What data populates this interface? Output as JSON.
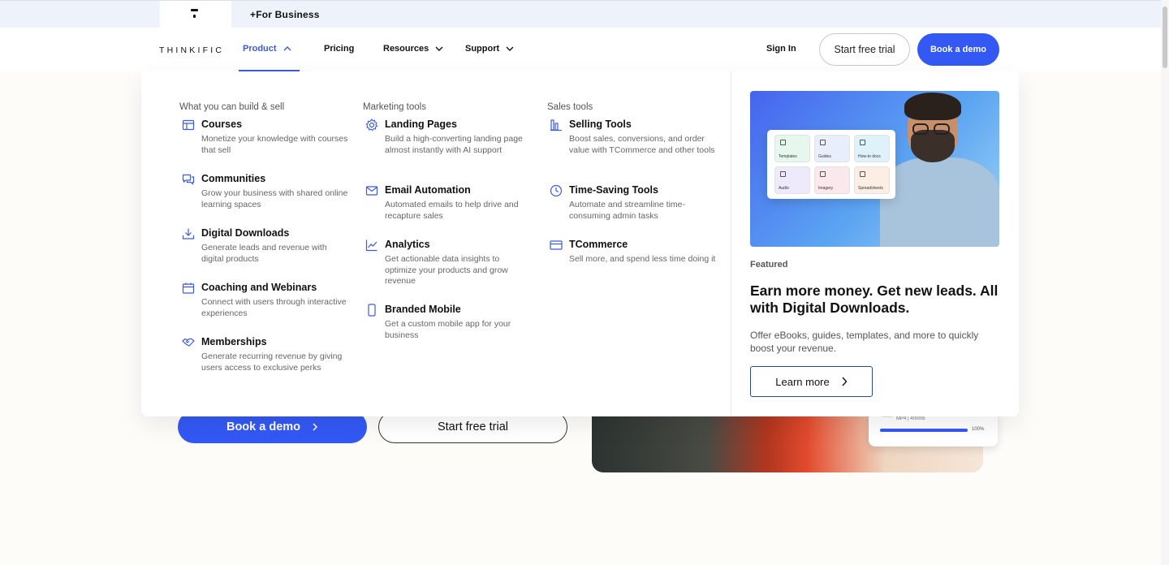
{
  "topbar": {
    "for_business": "+For Business"
  },
  "nav": {
    "logo": "THINKIFIC",
    "items": [
      {
        "label": "Product",
        "has_menu": true,
        "active": true
      },
      {
        "label": "Pricing",
        "has_menu": false,
        "active": false
      },
      {
        "label": "Resources",
        "has_menu": true,
        "active": false
      },
      {
        "label": "Support",
        "has_menu": true,
        "active": false
      }
    ],
    "sign_in": "Sign In",
    "start_trial": "Start free trial",
    "book_demo": "Book a demo",
    "accent_color": "#3358f4"
  },
  "menu": {
    "columns": [
      {
        "heading": "What you can build & sell",
        "entries": [
          {
            "icon": "layout-icon",
            "title": "Courses",
            "desc": "Monetize your knowledge with courses that sell"
          },
          {
            "icon": "chat-icon",
            "title": "Communities",
            "desc": "Grow your business with shared online learning spaces"
          },
          {
            "icon": "download-icon",
            "title": "Digital Downloads",
            "desc": "Generate leads and revenue with digital products"
          },
          {
            "icon": "calendar-icon",
            "title": "Coaching and Webinars",
            "desc": "Connect with users through interactive experiences"
          },
          {
            "icon": "handshake-icon",
            "title": "Memberships",
            "desc": "Generate recurring revenue by giving users access to exclusive perks"
          }
        ]
      },
      {
        "heading": "Marketing tools",
        "entries": [
          {
            "icon": "gear-icon",
            "title": "Landing Pages",
            "desc": "Build a high-converting landing page almost instantly with AI support"
          },
          {
            "icon": "mail-icon",
            "title": "Email Automation",
            "desc": "Automated emails to help drive and recapture sales"
          },
          {
            "icon": "analytics-icon",
            "title": "Analytics",
            "desc": "Get actionable data insights to optimize your products and grow revenue"
          },
          {
            "icon": "mobile-icon",
            "title": "Branded Mobile",
            "desc": "Get a custom mobile app for your business"
          }
        ]
      },
      {
        "heading": "Sales tools",
        "entries": [
          {
            "icon": "bar-chart-icon",
            "title": "Selling Tools",
            "desc": "Boost sales, conversions, and order value with TCommerce and other tools"
          },
          {
            "icon": "clock-icon",
            "title": "Time-Saving Tools",
            "desc": "Automate and streamline time-consuming admin tasks"
          },
          {
            "icon": "card-icon",
            "title": "TCommerce",
            "desc": "Sell more, and spend less time doing it"
          }
        ]
      }
    ]
  },
  "featured": {
    "label": "Featured",
    "title": "Earn more money. Get new leads. All with Digital Downloads.",
    "description": "Offer eBooks, guides, templates, and more to quickly boost your revenue.",
    "cta": "Learn more",
    "tiles": [
      {
        "label": "Templates",
        "color": "#e6f7ee"
      },
      {
        "label": "Guides",
        "color": "#e8eefb"
      },
      {
        "label": "How-to docs",
        "color": "#dff1fb"
      },
      {
        "label": "Audio",
        "color": "#eee9fb"
      },
      {
        "label": "Imagery",
        "color": "#fbe8ec"
      },
      {
        "label": "Spreadsheets",
        "color": "#fdeee4"
      }
    ]
  },
  "hero": {
    "book_demo": "Book a demo",
    "start_trial": "Start free trial",
    "upload_meta": "MP4 | 400mb",
    "upload_pct": "100%",
    "upload_progress": 1.0
  }
}
